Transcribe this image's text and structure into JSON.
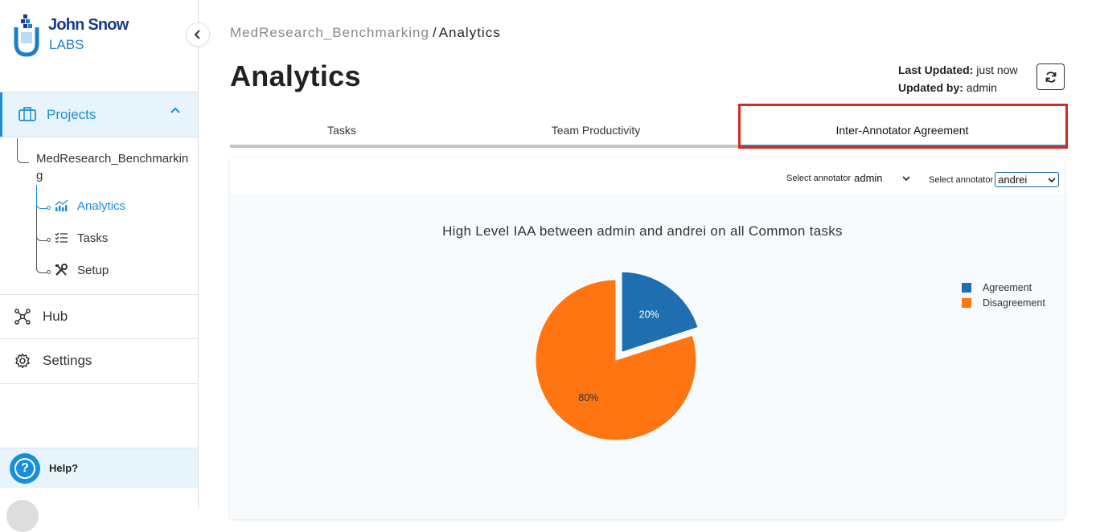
{
  "brand": {
    "line1": "John Snow",
    "line2": "LABS"
  },
  "sidebar": {
    "projects_label": "Projects",
    "project_name": "MedResearch_Benchmarking",
    "sub_items": [
      {
        "label": "Analytics",
        "icon": "analytics-icon",
        "active": true
      },
      {
        "label": "Tasks",
        "icon": "tasks-icon",
        "active": false
      },
      {
        "label": "Setup",
        "icon": "setup-icon",
        "active": false
      }
    ],
    "hub_label": "Hub",
    "settings_label": "Settings",
    "help_label": "Help?"
  },
  "header": {
    "breadcrumb_parent": "MedResearch_Benchmarking",
    "breadcrumb_sep": "/",
    "breadcrumb_current": "Analytics",
    "title": "Analytics",
    "last_updated_label": "Last Updated:",
    "last_updated_value": "just now",
    "updated_by_label": "Updated by:",
    "updated_by_value": "admin"
  },
  "tabs": [
    {
      "label": "Tasks",
      "active": false
    },
    {
      "label": "Team Productivity",
      "active": false
    },
    {
      "label": "Inter-Annotator Agreement",
      "active": true
    }
  ],
  "selectors": {
    "a_label": "Select annotator",
    "a_value": "admin",
    "b_label": "Select annotator",
    "b_value": "andrei"
  },
  "chart_data": {
    "type": "pie",
    "title": "High Level IAA between admin and andrei on all Common tasks",
    "categories": [
      "Agreement",
      "Disagreement"
    ],
    "values": [
      20,
      80
    ],
    "labels": [
      "20%",
      "80%"
    ],
    "colors": [
      "#1f6eb0",
      "#ff7512"
    ],
    "legend": "top-right"
  },
  "colors": {
    "accent": "#1a8fd8",
    "highlight": "#d52b1e"
  }
}
